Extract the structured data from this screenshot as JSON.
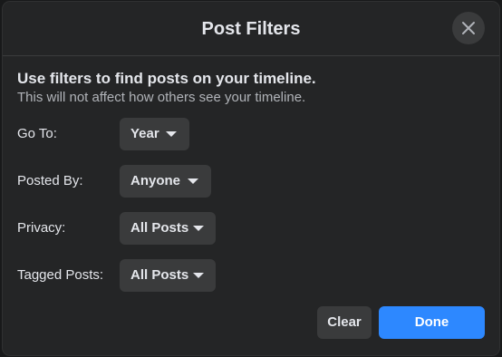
{
  "dialog": {
    "title": "Post Filters",
    "close_icon": "close-icon",
    "intro_heading": "Use filters to find posts on your timeline.",
    "intro_sub": "This will not affect how others see your timeline."
  },
  "filters": {
    "go_to": {
      "label": "Go To:",
      "value": "Year"
    },
    "posted_by": {
      "label": "Posted By:",
      "value": "Anyone"
    },
    "privacy": {
      "label": "Privacy:",
      "value": "All Posts"
    },
    "tagged_posts": {
      "label": "Tagged Posts:",
      "value": "All Posts"
    }
  },
  "actions": {
    "clear_label": "Clear",
    "done_label": "Done"
  },
  "colors": {
    "background": "#18191a",
    "surface": "#242526",
    "control": "#3a3b3c",
    "primary_text": "#e4e6eb",
    "secondary_text": "#b0b3b8",
    "accent": "#2d88ff"
  }
}
